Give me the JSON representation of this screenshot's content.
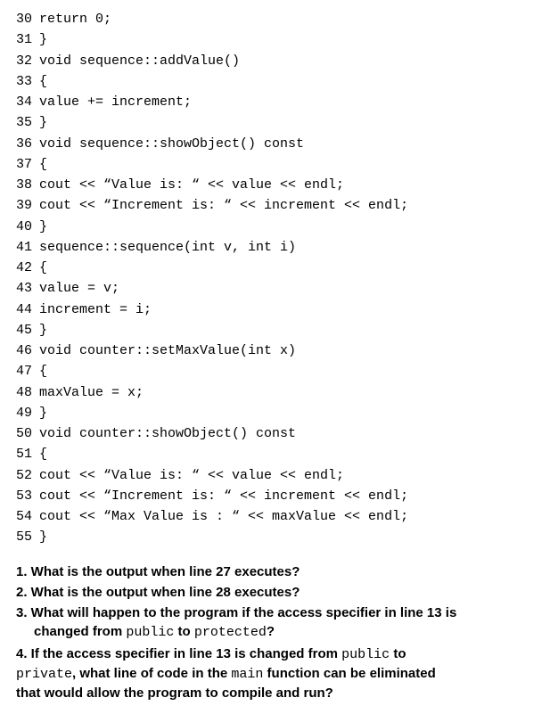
{
  "code_lines": [
    {
      "n": "30",
      "t": "return 0;"
    },
    {
      "n": "31",
      "t": "}"
    },
    {
      "n": "32",
      "t": "void sequence::addValue()"
    },
    {
      "n": "33",
      "t": "{"
    },
    {
      "n": "34",
      "t": "value += increment;"
    },
    {
      "n": "35",
      "t": "}"
    },
    {
      "n": "36",
      "t": "void sequence::showObject() const"
    },
    {
      "n": "37",
      "t": "{"
    },
    {
      "n": "38",
      "t": "cout << “Value is: “ << value << endl;"
    },
    {
      "n": "39",
      "t": "cout << “Increment is: “ << increment << endl;"
    },
    {
      "n": "40",
      "t": "}"
    },
    {
      "n": "41",
      "t": "sequence::sequence(int v, int i)"
    },
    {
      "n": "42",
      "t": "{"
    },
    {
      "n": "43",
      "t": "value = v;"
    },
    {
      "n": "44",
      "t": "increment = i;"
    },
    {
      "n": "45",
      "t": "}"
    },
    {
      "n": "46",
      "t": "void counter::setMaxValue(int x)"
    },
    {
      "n": "47",
      "t": "{"
    },
    {
      "n": "48",
      "t": "maxValue = x;"
    },
    {
      "n": "49",
      "t": "}"
    },
    {
      "n": "50",
      "t": "void counter::showObject() const"
    },
    {
      "n": "51",
      "t": "{"
    },
    {
      "n": "52",
      "t": "cout << “Value is: “ << value << endl;"
    },
    {
      "n": "53",
      "t": "cout << “Increment is: “ << increment << endl;"
    },
    {
      "n": "54",
      "t": "cout << “Max Value is : “ << maxValue << endl;"
    },
    {
      "n": "55",
      "t": "}"
    }
  ],
  "q1": "1. What is the output when line 27 executes?",
  "q2": "2. What is the output when line 28 executes?",
  "q3a": "3. What will happen to the program if the access specifier in line 13 is",
  "q3b": "changed from ",
  "q3b_code1": "public",
  "q3b_mid": " to ",
  "q3b_code2": "protected",
  "q3b_end": "?",
  "q4a": "4. If the access specifier in line 13 is changed from ",
  "q4a_code1": "public",
  "q4a_mid": " to",
  "q4b_code1": "private",
  "q4b_mid": ", what line of code in the ",
  "q4b_code2": "main",
  "q4b_end": " function can be eliminated",
  "q4c": "that would allow the program to compile and run?"
}
